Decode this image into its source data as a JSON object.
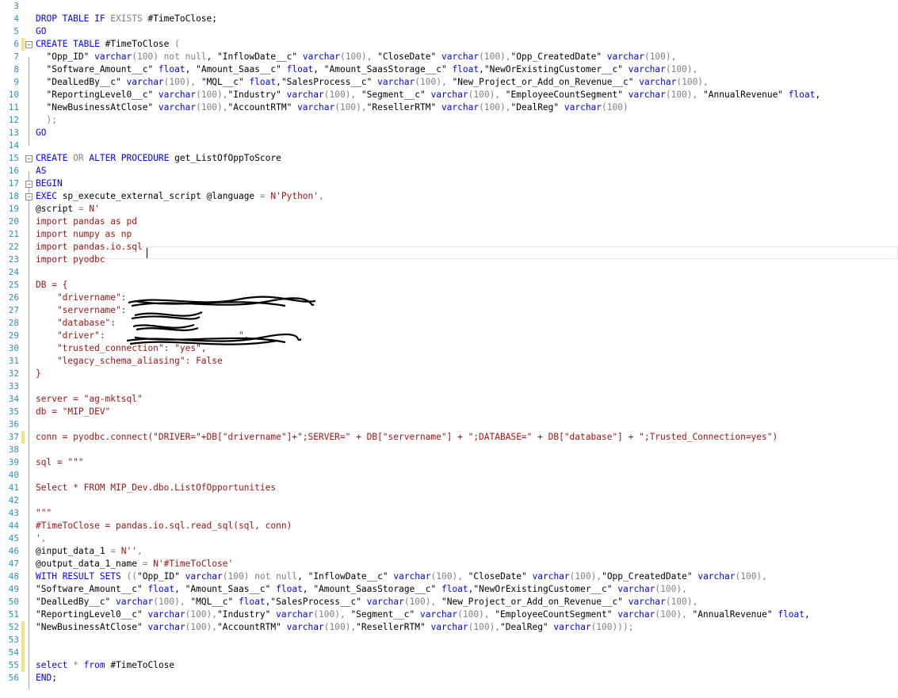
{
  "editor": {
    "lines": [
      {
        "n": "3",
        "segs": []
      },
      {
        "n": "4",
        "segs": [
          {
            "t": "DROP TABLE IF ",
            "c": "kw"
          },
          {
            "t": "EXISTS",
            "c": "gray"
          },
          {
            "t": " #TimeToClose;"
          }
        ]
      },
      {
        "n": "5",
        "segs": [
          {
            "t": "GO",
            "c": "kw"
          }
        ]
      },
      {
        "n": "6",
        "fold": "−",
        "bar": "yellow",
        "segs": [
          {
            "t": "CREATE TABLE",
            "c": "kw"
          },
          {
            "t": " #TimeToClose "
          },
          {
            "t": "(",
            "c": "gray"
          }
        ]
      },
      {
        "n": "7",
        "segs": [
          {
            "t": "  \"Opp_ID\" "
          },
          {
            "t": "varchar",
            "c": "kw"
          },
          {
            "t": "(100) ",
            "c": "gray"
          },
          {
            "t": "not null",
            "c": "gray"
          },
          {
            "t": ", "
          },
          {
            "t": "\"InflowDate__c\" "
          },
          {
            "t": "varchar",
            "c": "kw"
          },
          {
            "t": "(100), ",
            "c": "gray"
          },
          {
            "t": "\"CloseDate\" "
          },
          {
            "t": "varchar",
            "c": "kw"
          },
          {
            "t": "(100),",
            "c": "gray"
          },
          {
            "t": "\"Opp_CreatedDate\" "
          },
          {
            "t": "varchar",
            "c": "kw"
          },
          {
            "t": "(100),",
            "c": "gray"
          }
        ]
      },
      {
        "n": "8",
        "segs": [
          {
            "t": "  \"Software_Amount__c\" "
          },
          {
            "t": "float",
            "c": "kw"
          },
          {
            "t": ", "
          },
          {
            "t": "\"Amount_Saas__c\" "
          },
          {
            "t": "float",
            "c": "kw"
          },
          {
            "t": ", "
          },
          {
            "t": "\"Amount_SaasStorage__c\" "
          },
          {
            "t": "float",
            "c": "kw"
          },
          {
            "t": ","
          },
          {
            "t": "\"NewOrExistingCustomer__c\" "
          },
          {
            "t": "varchar",
            "c": "kw"
          },
          {
            "t": "(100),",
            "c": "gray"
          }
        ]
      },
      {
        "n": "9",
        "segs": [
          {
            "t": "  \"DealLedBy__c\" "
          },
          {
            "t": "varchar",
            "c": "kw"
          },
          {
            "t": "(100), ",
            "c": "gray"
          },
          {
            "t": "\"MQL__c\" "
          },
          {
            "t": "float",
            "c": "kw"
          },
          {
            "t": ","
          },
          {
            "t": "\"SalesProcess__c\" "
          },
          {
            "t": "varchar",
            "c": "kw"
          },
          {
            "t": "(100), ",
            "c": "gray"
          },
          {
            "t": "\"New_Project_or_Add_on_Revenue__c\" "
          },
          {
            "t": "varchar",
            "c": "kw"
          },
          {
            "t": "(100),",
            "c": "gray"
          }
        ]
      },
      {
        "n": "10",
        "segs": [
          {
            "t": "  \"ReportingLevel0__c\" "
          },
          {
            "t": "varchar",
            "c": "kw"
          },
          {
            "t": "(100),",
            "c": "gray"
          },
          {
            "t": "\"Industry\" "
          },
          {
            "t": "varchar",
            "c": "kw"
          },
          {
            "t": "(100), ",
            "c": "gray"
          },
          {
            "t": "\"Segment__c\" "
          },
          {
            "t": "varchar",
            "c": "kw"
          },
          {
            "t": "(100), ",
            "c": "gray"
          },
          {
            "t": "\"EmployeeCountSegment\" "
          },
          {
            "t": "varchar",
            "c": "kw"
          },
          {
            "t": "(100), ",
            "c": "gray"
          },
          {
            "t": "\"AnnualRevenue\" "
          },
          {
            "t": "float",
            "c": "kw"
          },
          {
            "t": ","
          }
        ]
      },
      {
        "n": "11",
        "segs": [
          {
            "t": "  \"NewBusinessAtClose\" "
          },
          {
            "t": "varchar",
            "c": "kw"
          },
          {
            "t": "(100),",
            "c": "gray"
          },
          {
            "t": "\"AccountRTM\" "
          },
          {
            "t": "varchar",
            "c": "kw"
          },
          {
            "t": "(100),",
            "c": "gray"
          },
          {
            "t": "\"ResellerRTM\" "
          },
          {
            "t": "varchar",
            "c": "kw"
          },
          {
            "t": "(100),",
            "c": "gray"
          },
          {
            "t": "\"DealReg\" "
          },
          {
            "t": "varchar",
            "c": "kw"
          },
          {
            "t": "(100)",
            "c": "gray"
          }
        ]
      },
      {
        "n": "12",
        "segs": [
          {
            "t": "  );",
            "c": "gray"
          }
        ]
      },
      {
        "n": "13",
        "segs": [
          {
            "t": "GO",
            "c": "kw"
          }
        ]
      },
      {
        "n": "14",
        "segs": []
      },
      {
        "n": "15",
        "fold": "−",
        "segs": [
          {
            "t": "CREATE",
            "c": "kw"
          },
          {
            "t": " OR ",
            "c": "gray"
          },
          {
            "t": "ALTER PROCEDURE",
            "c": "kw"
          },
          {
            "t": " get_ListOfOppToScore"
          }
        ]
      },
      {
        "n": "16",
        "segs": [
          {
            "t": "AS",
            "c": "kw"
          }
        ]
      },
      {
        "n": "17",
        "fold": "−",
        "segs": [
          {
            "t": "BEGIN",
            "c": "kw"
          }
        ]
      },
      {
        "n": "18",
        "fold": "−",
        "segs": [
          {
            "t": "EXEC",
            "c": "kw"
          },
          {
            "t": " sp_execute_external_script @language "
          },
          {
            "t": "=",
            "c": "gray"
          },
          {
            "t": " N'Python'",
            "c": "str"
          },
          {
            "t": ",",
            "c": "gray"
          }
        ]
      },
      {
        "n": "19",
        "segs": [
          {
            "t": "@script "
          },
          {
            "t": "=",
            "c": "gray"
          },
          {
            "t": " N'",
            "c": "str"
          }
        ]
      },
      {
        "n": "20",
        "segs": [
          {
            "t": "import pandas as pd",
            "c": "str"
          }
        ]
      },
      {
        "n": "21",
        "segs": [
          {
            "t": "import numpy as np",
            "c": "str"
          }
        ]
      },
      {
        "n": "22",
        "segs": [
          {
            "t": "import pandas.io.sql",
            "c": "str"
          }
        ]
      },
      {
        "n": "23",
        "segs": [
          {
            "t": "import pyodbc",
            "c": "str"
          }
        ]
      },
      {
        "n": "24",
        "segs": []
      },
      {
        "n": "25",
        "segs": [
          {
            "t": "DB = {",
            "c": "str"
          }
        ]
      },
      {
        "n": "26",
        "segs": [
          {
            "t": "    \"drivername\":",
            "c": "str"
          }
        ]
      },
      {
        "n": "27",
        "segs": [
          {
            "t": "    \"servername\":",
            "c": "str"
          }
        ]
      },
      {
        "n": "28",
        "segs": [
          {
            "t": "    \"database\":",
            "c": "str"
          }
        ]
      },
      {
        "n": "29",
        "segs": [
          {
            "t": "    \"driver\": ",
            "c": "str"
          },
          {
            "t": "                        ",
            "c": "str"
          },
          {
            "t": "\",",
            "c": "str"
          }
        ]
      },
      {
        "n": "30",
        "segs": [
          {
            "t": "    \"trusted_connection\": \"yes\",",
            "c": "str"
          }
        ]
      },
      {
        "n": "31",
        "segs": [
          {
            "t": "    \"legacy_schema_aliasing\": False",
            "c": "str"
          }
        ]
      },
      {
        "n": "32",
        "segs": [
          {
            "t": "}",
            "c": "str"
          }
        ]
      },
      {
        "n": "33",
        "segs": []
      },
      {
        "n": "34",
        "segs": [
          {
            "t": "server = \"ag-mktsql\"",
            "c": "str"
          }
        ]
      },
      {
        "n": "35",
        "segs": [
          {
            "t": "db = \"MIP_DEV\"",
            "c": "str"
          }
        ]
      },
      {
        "n": "36",
        "segs": []
      },
      {
        "n": "37",
        "bar": "yellow",
        "segs": [
          {
            "t": "conn = pyodbc.connect(\"DRIVER=\"+DB[\"drivername\"]+\";SERVER=\" + DB[\"servername\"] + \";DATABASE=\" + DB[\"database\"] + \";Trusted_Connection=yes\")",
            "c": "str"
          }
        ]
      },
      {
        "n": "38",
        "segs": []
      },
      {
        "n": "39",
        "segs": [
          {
            "t": "sql = \"\"\"",
            "c": "str"
          }
        ]
      },
      {
        "n": "40",
        "segs": []
      },
      {
        "n": "41",
        "segs": [
          {
            "t": "Select * FROM MIP_Dev.dbo.ListOfOpportunities",
            "c": "str"
          }
        ]
      },
      {
        "n": "42",
        "segs": []
      },
      {
        "n": "43",
        "segs": [
          {
            "t": "\"\"\"",
            "c": "str"
          }
        ]
      },
      {
        "n": "44",
        "segs": [
          {
            "t": "#TimeToClose = pandas.io.sql.read_sql(sql, conn)",
            "c": "str"
          }
        ]
      },
      {
        "n": "45",
        "segs": [
          {
            "t": "'",
            "c": "str"
          },
          {
            "t": ",",
            "c": "gray"
          }
        ]
      },
      {
        "n": "46",
        "segs": [
          {
            "t": "@input_data_1 "
          },
          {
            "t": "=",
            "c": "gray"
          },
          {
            "t": " N''",
            "c": "str"
          },
          {
            "t": ",",
            "c": "gray"
          }
        ]
      },
      {
        "n": "47",
        "segs": [
          {
            "t": "@output_data_1_name "
          },
          {
            "t": "=",
            "c": "gray"
          },
          {
            "t": " N'#TimeToClose'",
            "c": "str"
          }
        ]
      },
      {
        "n": "48",
        "segs": [
          {
            "t": "WITH",
            "c": "kw"
          },
          {
            "t": " RESULT SETS ",
            "c": "kw"
          },
          {
            "t": "((",
            "c": "gray"
          },
          {
            "t": "\"Opp_ID\" "
          },
          {
            "t": "varchar",
            "c": "kw"
          },
          {
            "t": "(100) ",
            "c": "gray"
          },
          {
            "t": "not null",
            "c": "gray"
          },
          {
            "t": ", "
          },
          {
            "t": "\"InflowDate__c\" "
          },
          {
            "t": "varchar",
            "c": "kw"
          },
          {
            "t": "(100), ",
            "c": "gray"
          },
          {
            "t": "\"CloseDate\" "
          },
          {
            "t": "varchar",
            "c": "kw"
          },
          {
            "t": "(100),",
            "c": "gray"
          },
          {
            "t": "\"Opp_CreatedDate\" "
          },
          {
            "t": "varchar",
            "c": "kw"
          },
          {
            "t": "(100),",
            "c": "gray"
          }
        ]
      },
      {
        "n": "49",
        "segs": [
          {
            "t": "\"Software_Amount__c\" "
          },
          {
            "t": "float",
            "c": "kw"
          },
          {
            "t": ", "
          },
          {
            "t": "\"Amount_Saas__c\" "
          },
          {
            "t": "float",
            "c": "kw"
          },
          {
            "t": ", "
          },
          {
            "t": "\"Amount_SaasStorage__c\" "
          },
          {
            "t": "float",
            "c": "kw"
          },
          {
            "t": ","
          },
          {
            "t": "\"NewOrExistingCustomer__c\" "
          },
          {
            "t": "varchar",
            "c": "kw"
          },
          {
            "t": "(100),",
            "c": "gray"
          }
        ]
      },
      {
        "n": "50",
        "segs": [
          {
            "t": "\"DealLedBy__c\" "
          },
          {
            "t": "varchar",
            "c": "kw"
          },
          {
            "t": "(100), ",
            "c": "gray"
          },
          {
            "t": "\"MQL__c\" "
          },
          {
            "t": "float",
            "c": "kw"
          },
          {
            "t": ","
          },
          {
            "t": "\"SalesProcess__c\" "
          },
          {
            "t": "varchar",
            "c": "kw"
          },
          {
            "t": "(100), ",
            "c": "gray"
          },
          {
            "t": "\"New_Project_or_Add_on_Revenue__c\" "
          },
          {
            "t": "varchar",
            "c": "kw"
          },
          {
            "t": "(100),",
            "c": "gray"
          }
        ]
      },
      {
        "n": "51",
        "segs": [
          {
            "t": "\"ReportingLevel0__c\" "
          },
          {
            "t": "varchar",
            "c": "kw"
          },
          {
            "t": "(100),",
            "c": "gray"
          },
          {
            "t": "\"Industry\" "
          },
          {
            "t": "varchar",
            "c": "kw"
          },
          {
            "t": "(100), ",
            "c": "gray"
          },
          {
            "t": "\"Segment__c\" "
          },
          {
            "t": "varchar",
            "c": "kw"
          },
          {
            "t": "(100), ",
            "c": "gray"
          },
          {
            "t": "\"EmployeeCountSegment\" "
          },
          {
            "t": "varchar",
            "c": "kw"
          },
          {
            "t": "(100), ",
            "c": "gray"
          },
          {
            "t": "\"AnnualRevenue\" "
          },
          {
            "t": "float",
            "c": "kw"
          },
          {
            "t": ","
          }
        ]
      },
      {
        "n": "52",
        "bar": "yellow",
        "segs": [
          {
            "t": "\"NewBusinessAtClose\" "
          },
          {
            "t": "varchar",
            "c": "kw"
          },
          {
            "t": "(100),",
            "c": "gray"
          },
          {
            "t": "\"AccountRTM\" "
          },
          {
            "t": "varchar",
            "c": "kw"
          },
          {
            "t": "(100),",
            "c": "gray"
          },
          {
            "t": "\"ResellerRTM\" "
          },
          {
            "t": "varchar",
            "c": "kw"
          },
          {
            "t": "(100),",
            "c": "gray"
          },
          {
            "t": "\"DealReg\" "
          },
          {
            "t": "varchar",
            "c": "kw"
          },
          {
            "t": "(100)));",
            "c": "gray"
          }
        ]
      },
      {
        "n": "53",
        "bar": "yellow",
        "segs": []
      },
      {
        "n": "54",
        "bar": "yellow",
        "segs": []
      },
      {
        "n": "55",
        "bar": "yellow",
        "segs": [
          {
            "t": "select",
            "c": "kw"
          },
          {
            "t": " * ",
            "c": "gray"
          },
          {
            "t": "from",
            "c": "kw"
          },
          {
            "t": " #TimeToClose"
          }
        ]
      },
      {
        "n": "56",
        "segs": [
          {
            "t": "END",
            "c": "kw"
          },
          {
            "t": ";"
          }
        ]
      }
    ]
  },
  "colors": {
    "keyword": "#0000ff",
    "string": "#a31515",
    "operator": "#808080",
    "line_number": "#2b91af",
    "changed_marker": "#f4e27a"
  }
}
